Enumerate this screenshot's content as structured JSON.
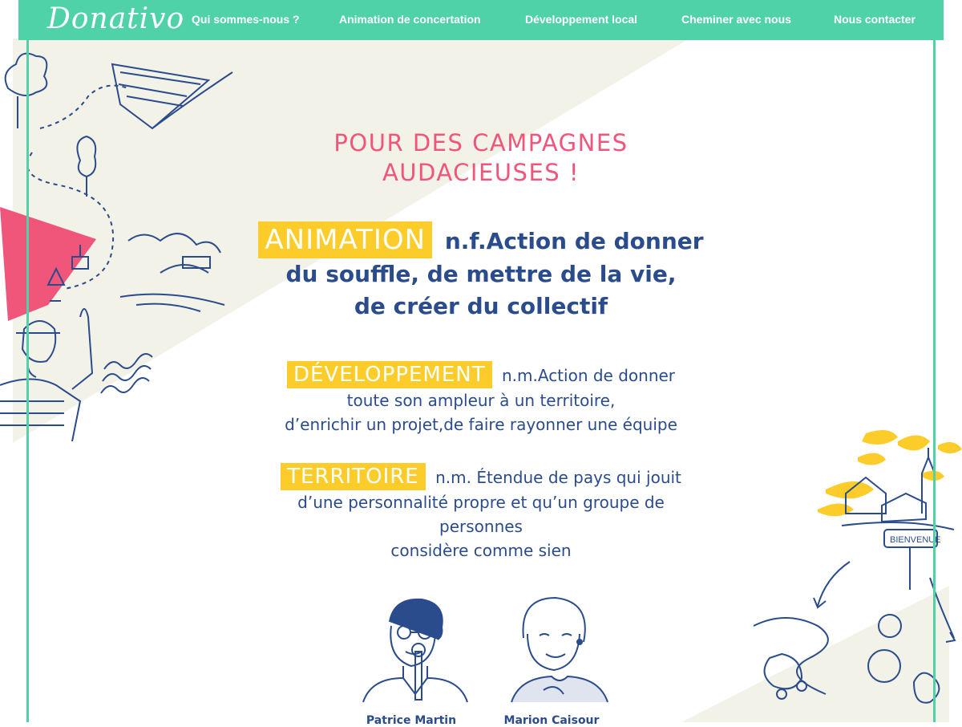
{
  "header": {
    "logo": "Donativo",
    "nav": [
      {
        "label": "Qui sommes-nous ?"
      },
      {
        "label": "Animation de concertation"
      },
      {
        "label": "Développement local"
      },
      {
        "label": "Cheminer avec nous"
      },
      {
        "label": "Nous contacter"
      }
    ]
  },
  "main": {
    "headline_line1": "POUR DES CAMPAGNES",
    "headline_line2": "AUDACIEUSES !",
    "definitions": [
      {
        "term": "ANIMATION",
        "lines": [
          "n.f.Action de donner",
          "du souffle, de mettre de la vie,",
          "de créer du collectif"
        ]
      },
      {
        "term": "DÉVELOPPEMENT",
        "lines": [
          "n.m.Action de donner",
          "toute son ampleur à un territoire,",
          "d’enrichir un projet,de faire rayonner une équipe"
        ]
      },
      {
        "term": "TERRITOIRE",
        "lines": [
          "n.m. Étendue de pays qui jouit",
          "d’une personnalité propre et qu’un groupe de",
          "personnes",
          "considère comme sien"
        ]
      }
    ],
    "team": [
      {
        "name": "Patrice Martin"
      },
      {
        "name": "Marion Caisour"
      }
    ],
    "sign_text": "BIENVENUE"
  },
  "colors": {
    "accent_green": "#50d2a9",
    "headline_pink": "#f0557a",
    "text_blue": "#2b4c8c",
    "highlight_yellow": "#fccd2a",
    "beige": "#f3f2e8"
  }
}
